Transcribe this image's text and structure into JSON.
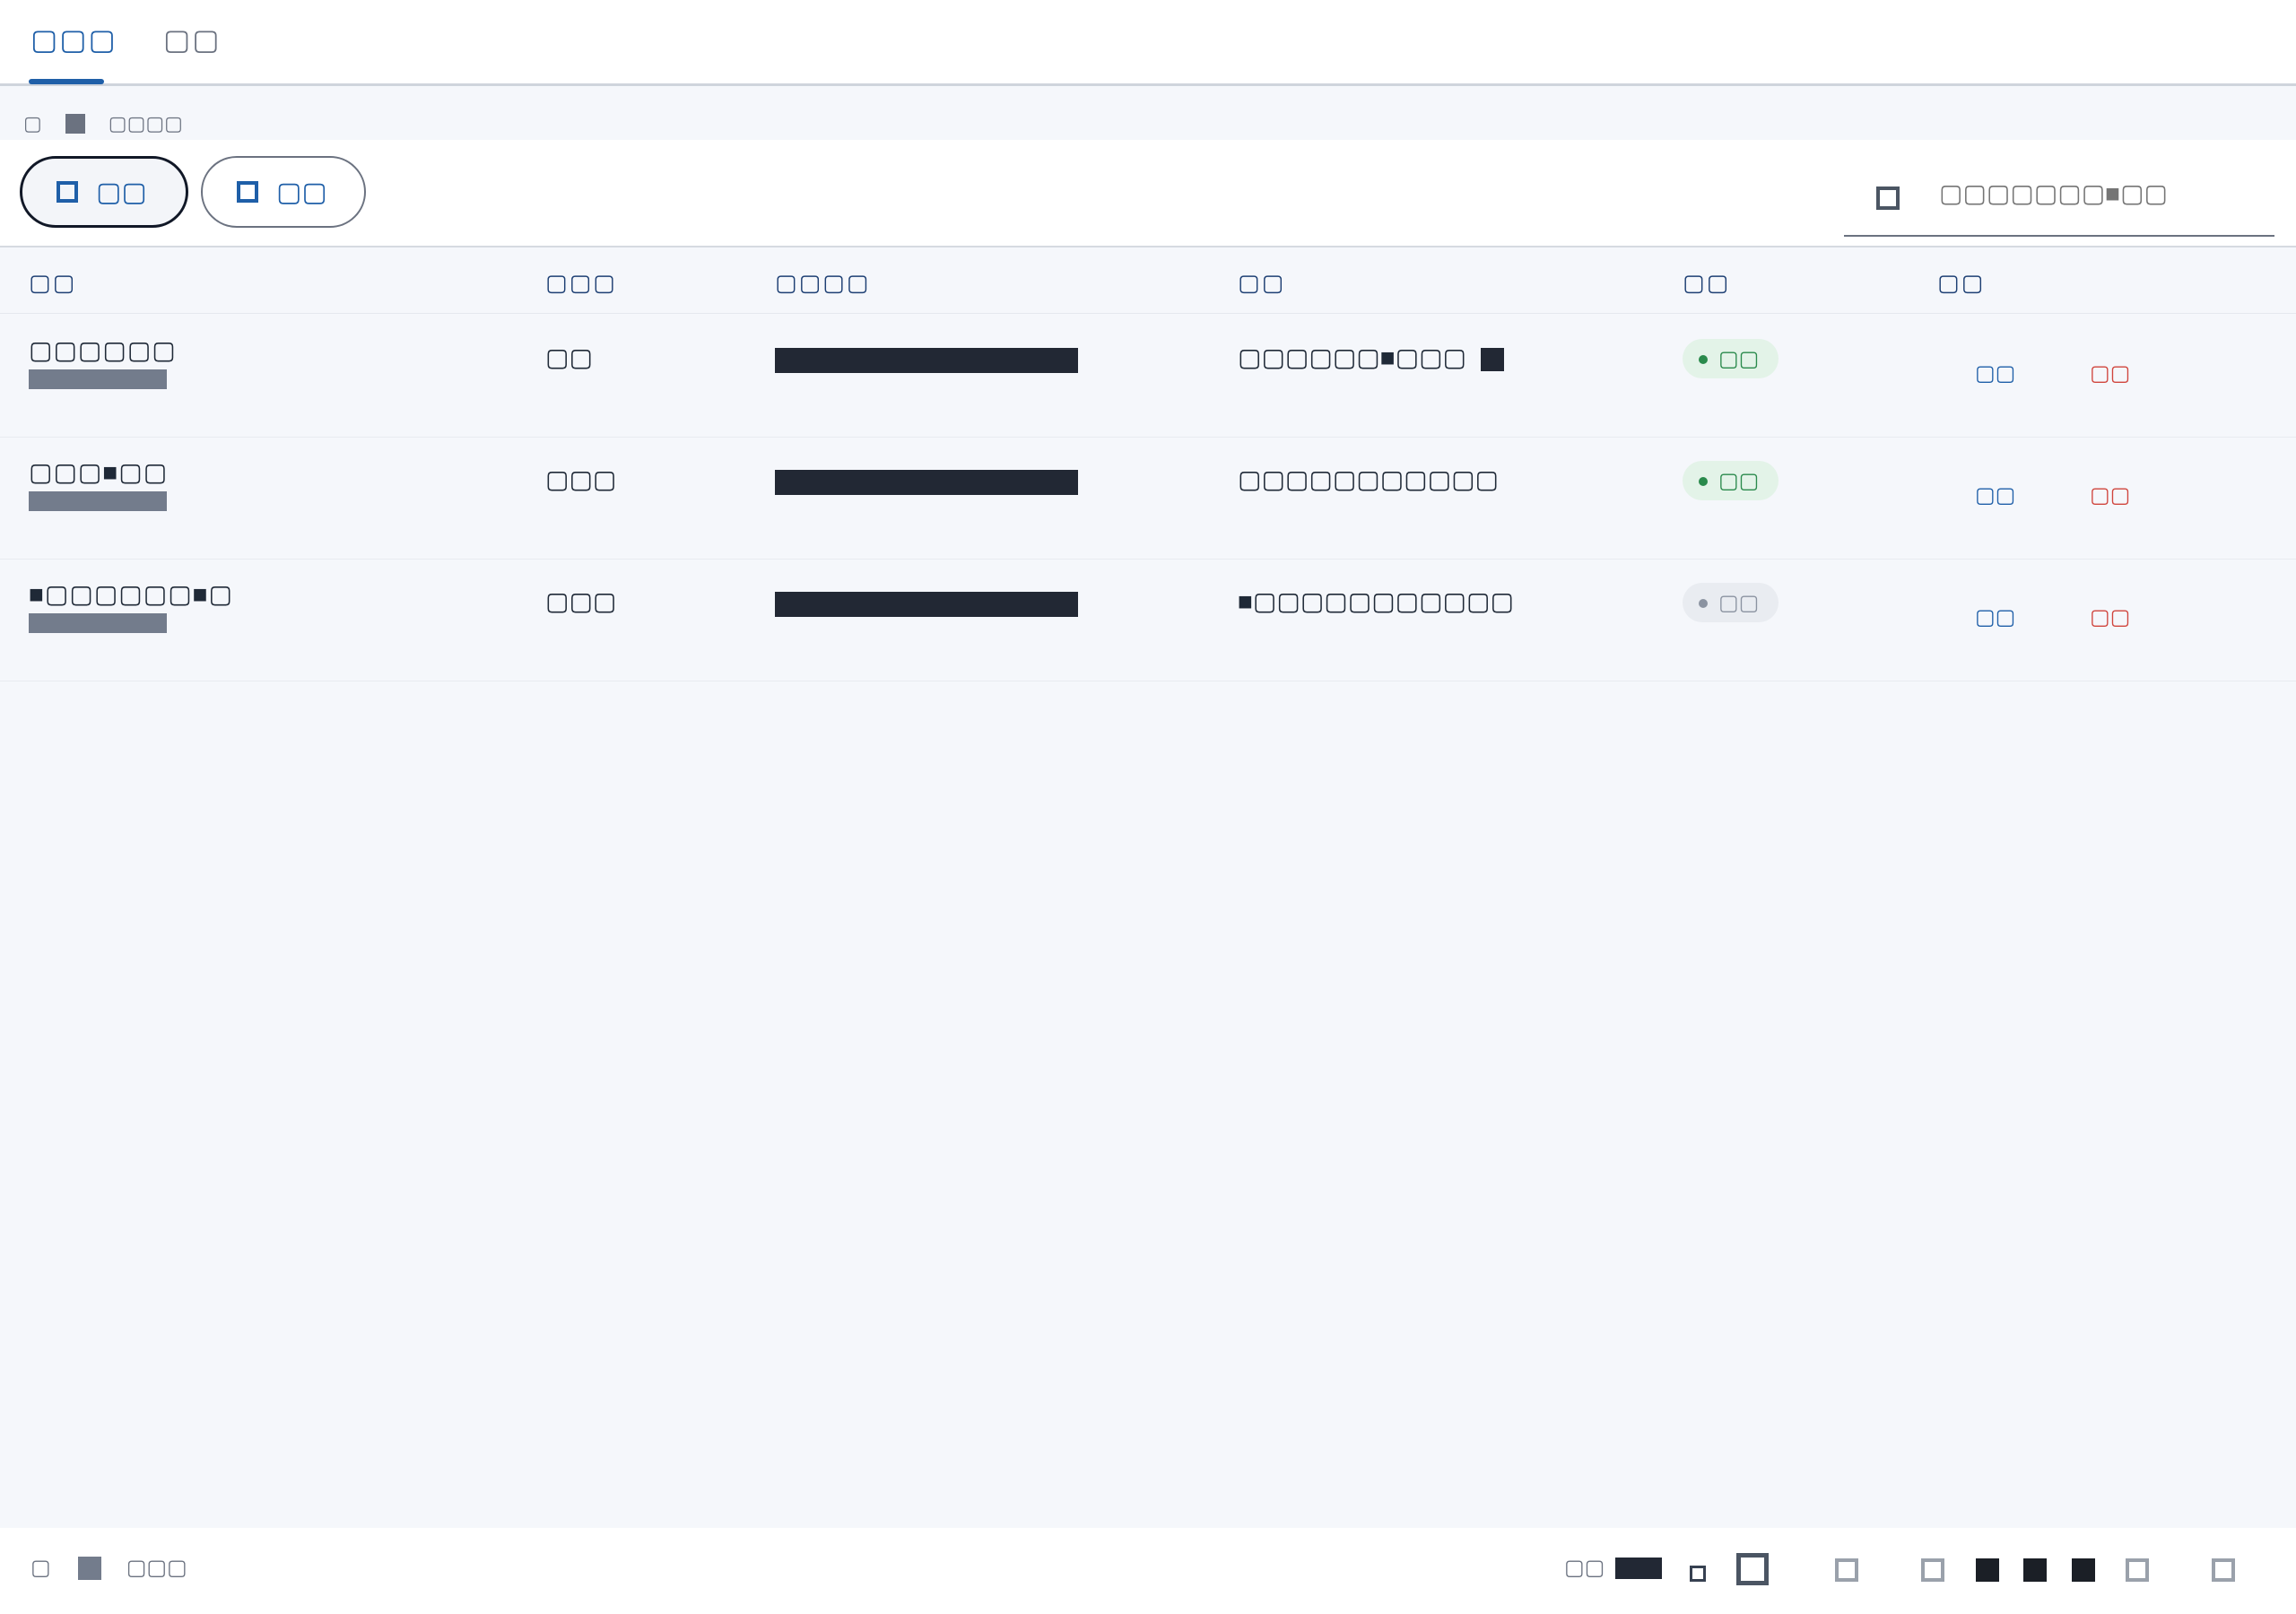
{
  "tabs": [
    {
      "label": "▢▢▢",
      "active": true
    },
    {
      "label": "▢▢",
      "active": false
    }
  ],
  "summary": {
    "prefix": "▢",
    "suffix": "▢▢▢▢"
  },
  "filters": [
    {
      "label": "▢▢",
      "selected": true
    },
    {
      "label": "▢▢",
      "selected": false
    }
  ],
  "search": {
    "placeholder": "▢▢▢▢▢▢▢■▢▢",
    "value": ""
  },
  "table": {
    "headers": [
      "▢▢",
      "▢▢▢",
      "▢▢▢▢",
      "▢▢",
      "▢▢",
      "▢▢"
    ],
    "rows": [
      {
        "name": "▢▢▢▢▢▢",
        "type": "▢▢",
        "path": "▢▢▢▢▢▢■▢▢▢",
        "status": "▢▢",
        "status_state": "on",
        "edit": "▢▢",
        "delete": "▢▢"
      },
      {
        "name": "▢▢▢■▢▢",
        "type": "▢▢▢",
        "path": "▢▢▢▢▢▢▢▢▢▢▢",
        "status": "▢▢",
        "status_state": "on",
        "edit": "▢▢",
        "delete": "▢▢"
      },
      {
        "name": "■▢▢▢▢▢▢■▢",
        "type": "▢▢▢",
        "path": "■▢▢▢▢▢▢▢▢▢▢▢",
        "status": "▢▢",
        "status_state": "off",
        "edit": "▢▢",
        "delete": "▢▢"
      }
    ]
  },
  "footer": {
    "summary_prefix": "▢",
    "summary_suffix": "▢▢▢",
    "rows_per_page_label": "▢▢"
  },
  "colors": {
    "accent": "#1f5fa8",
    "success": "#2a8a4c",
    "danger": "#d0453d",
    "muted": "#6b7280"
  }
}
